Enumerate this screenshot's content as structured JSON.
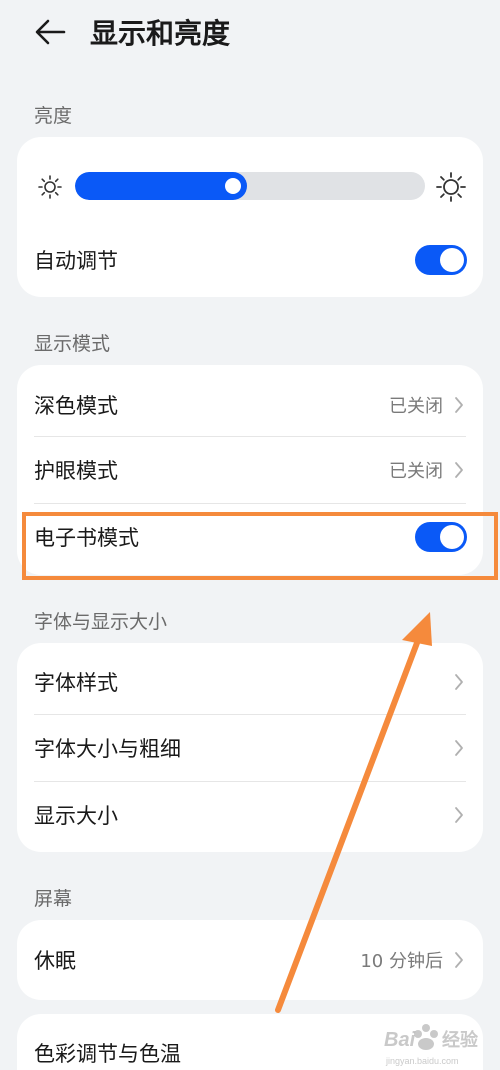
{
  "header": {
    "title": "显示和亮度",
    "back_icon": "arrow-left-icon"
  },
  "brightness": {
    "section_label": "亮度",
    "level": 0.45,
    "auto_label": "自动调节",
    "auto_enabled": true
  },
  "display_mode": {
    "section_label": "显示模式",
    "dark_mode": {
      "label": "深色模式",
      "value": "已关闭"
    },
    "eye_comfort": {
      "label": "护眼模式",
      "value": "已关闭"
    },
    "ebook_mode": {
      "label": "电子书模式",
      "enabled": true
    }
  },
  "font": {
    "section_label": "字体与显示大小",
    "items": [
      {
        "label": "字体样式"
      },
      {
        "label": "字体大小与粗细"
      },
      {
        "label": "显示大小"
      }
    ]
  },
  "screen": {
    "section_label": "屏幕",
    "sleep": {
      "label": "休眠",
      "value": "10 分钟后"
    },
    "color_temp": {
      "label": "色彩调节与色温"
    }
  },
  "colors": {
    "accent": "#0a59f7",
    "highlight": "#f58a3c",
    "background": "#f1f3f5"
  }
}
